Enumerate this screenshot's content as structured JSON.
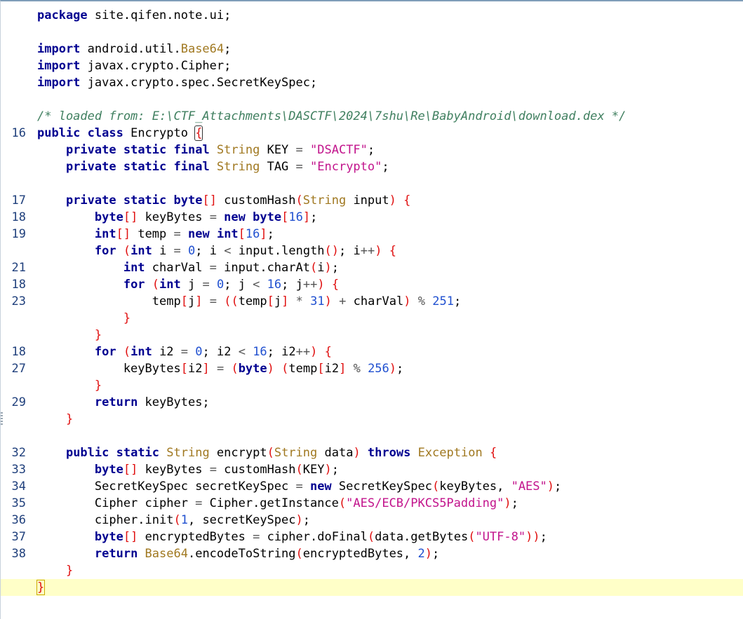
{
  "editor": {
    "lines": [
      {
        "n": "",
        "tokens": [
          [
            "kw",
            "package"
          ],
          [
            "",
            "site.qifen.note.ui;"
          ]
        ]
      },
      {
        "n": "",
        "tokens": []
      },
      {
        "n": "",
        "tokens": [
          [
            "kw",
            "import"
          ],
          [
            "",
            "android.util."
          ],
          [
            "ty",
            "Base64"
          ],
          [
            "",
            ";"
          ]
        ]
      },
      {
        "n": "",
        "tokens": [
          [
            "kw",
            "import"
          ],
          [
            "",
            "javax.crypto.Cipher;"
          ]
        ]
      },
      {
        "n": "",
        "tokens": [
          [
            "kw",
            "import"
          ],
          [
            "",
            "javax.crypto.spec.SecretKeySpec;"
          ]
        ]
      },
      {
        "n": "",
        "tokens": []
      },
      {
        "n": "",
        "tokens": [
          [
            "cm",
            "/* loaded from: E:\\CTF_Attachments\\DASCTF\\2024\\7shu\\Re\\BabyAndroid\\download.dex */"
          ]
        ]
      },
      {
        "n": "16",
        "tokens": [
          [
            "kw",
            "public"
          ],
          [
            "kw",
            "class"
          ],
          [
            "",
            "Encrypto "
          ],
          [
            "bm",
            "{"
          ]
        ]
      },
      {
        "n": "",
        "tokens": [
          [
            "",
            "    "
          ],
          [
            "kw",
            "private"
          ],
          [
            "kw",
            "static"
          ],
          [
            "kw",
            "final"
          ],
          [
            "ty",
            "String"
          ],
          [
            "",
            "KEY "
          ],
          [
            "op",
            "="
          ],
          [
            "str",
            " \"DSACTF\""
          ],
          [
            "",
            ";"
          ]
        ]
      },
      {
        "n": "",
        "tokens": [
          [
            "",
            "    "
          ],
          [
            "kw",
            "private"
          ],
          [
            "kw",
            "static"
          ],
          [
            "kw",
            "final"
          ],
          [
            "ty",
            "String"
          ],
          [
            "",
            "TAG "
          ],
          [
            "op",
            "="
          ],
          [
            "str",
            " \"Encrypto\""
          ],
          [
            "",
            ";"
          ]
        ]
      },
      {
        "n": "",
        "tokens": []
      },
      {
        "n": "17",
        "tokens": [
          [
            "",
            "    "
          ],
          [
            "kw",
            "private"
          ],
          [
            "kw",
            "static"
          ],
          [
            "kw",
            "byte"
          ],
          [
            "pu",
            "[]"
          ],
          [
            "",
            "",
            " customHash"
          ],
          [
            "pu",
            "("
          ],
          [
            "ty",
            "String"
          ],
          [
            "",
            " input"
          ],
          [
            "pu",
            ")"
          ],
          [
            "",
            "",
            " "
          ],
          [
            "pu",
            "{"
          ]
        ]
      },
      {
        "n": "18",
        "tokens": [
          [
            "",
            "        "
          ],
          [
            "kw",
            "byte"
          ],
          [
            "pu",
            "[]"
          ],
          [
            "",
            " keyBytes "
          ],
          [
            "op",
            "="
          ],
          [
            "kw",
            " new"
          ],
          [
            "kw",
            " byte"
          ],
          [
            "pu",
            "["
          ],
          [
            "nu",
            "16"
          ],
          [
            "pu",
            "]"
          ],
          [
            "",
            ";"
          ]
        ]
      },
      {
        "n": "19",
        "tokens": [
          [
            "",
            "        "
          ],
          [
            "kw",
            "int"
          ],
          [
            "pu",
            "[]"
          ],
          [
            "",
            " temp "
          ],
          [
            "op",
            "="
          ],
          [
            "kw",
            " new"
          ],
          [
            "kw",
            " int"
          ],
          [
            "pu",
            "["
          ],
          [
            "nu",
            "16"
          ],
          [
            "pu",
            "]"
          ],
          [
            "",
            ";"
          ]
        ]
      },
      {
        "n": "",
        "tokens": [
          [
            "",
            "        "
          ],
          [
            "kw",
            "for"
          ],
          [
            "",
            " "
          ],
          [
            "pu",
            "("
          ],
          [
            "kw",
            "int"
          ],
          [
            "",
            " i "
          ],
          [
            "op",
            "="
          ],
          [
            "nu",
            " 0"
          ],
          [
            "",
            "; i "
          ],
          [
            "op",
            "<"
          ],
          [
            "",
            " input.length"
          ],
          [
            "pu",
            "()"
          ],
          [
            "",
            "; i"
          ],
          [
            "op",
            "++"
          ],
          [
            "pu",
            ")"
          ],
          [
            "",
            " "
          ],
          [
            "pu",
            "{"
          ]
        ]
      },
      {
        "n": "21",
        "tokens": [
          [
            "",
            "            "
          ],
          [
            "kw",
            "int"
          ],
          [
            "",
            " charVal "
          ],
          [
            "op",
            "="
          ],
          [
            "",
            " input.charAt"
          ],
          [
            "pu",
            "("
          ],
          [
            "",
            "i"
          ],
          [
            "pu",
            ")"
          ],
          [
            "",
            ";"
          ]
        ]
      },
      {
        "n": "18",
        "tokens": [
          [
            "",
            "            "
          ],
          [
            "kw",
            "for"
          ],
          [
            "",
            " "
          ],
          [
            "pu",
            "("
          ],
          [
            "kw",
            "int"
          ],
          [
            "",
            " j "
          ],
          [
            "op",
            "="
          ],
          [
            "nu",
            " 0"
          ],
          [
            "",
            "; j "
          ],
          [
            "op",
            "<"
          ],
          [
            "nu",
            " 16"
          ],
          [
            "",
            "; j"
          ],
          [
            "op",
            "++"
          ],
          [
            "pu",
            ")"
          ],
          [
            "",
            " "
          ],
          [
            "pu",
            "{"
          ]
        ]
      },
      {
        "n": "23",
        "tokens": [
          [
            "",
            "                temp"
          ],
          [
            "pu",
            "["
          ],
          [
            "",
            "j"
          ],
          [
            "pu",
            "]"
          ],
          [
            "",
            " "
          ],
          [
            "op",
            "="
          ],
          [
            "",
            " "
          ],
          [
            "pu",
            "(("
          ],
          [
            "",
            "temp"
          ],
          [
            "pu",
            "["
          ],
          [
            "",
            "j"
          ],
          [
            "pu",
            "]"
          ],
          [
            "",
            " "
          ],
          [
            "op",
            "*"
          ],
          [
            "nu",
            " 31"
          ],
          [
            "pu",
            ")"
          ],
          [
            "",
            " "
          ],
          [
            "op",
            "+"
          ],
          [
            "",
            " charVal"
          ],
          [
            "pu",
            ")"
          ],
          [
            "",
            " "
          ],
          [
            "op",
            "%"
          ],
          [
            "nu",
            " 251"
          ],
          [
            "",
            ";"
          ]
        ]
      },
      {
        "n": "",
        "tokens": [
          [
            "",
            "            "
          ],
          [
            "pu",
            "}"
          ]
        ]
      },
      {
        "n": "",
        "tokens": [
          [
            "",
            "        "
          ],
          [
            "pu",
            "}"
          ]
        ]
      },
      {
        "n": "18",
        "tokens": [
          [
            "",
            "        "
          ],
          [
            "kw",
            "for"
          ],
          [
            "",
            " "
          ],
          [
            "pu",
            "("
          ],
          [
            "kw",
            "int"
          ],
          [
            "",
            " i2 "
          ],
          [
            "op",
            "="
          ],
          [
            "nu",
            " 0"
          ],
          [
            "",
            "; i2 "
          ],
          [
            "op",
            "<"
          ],
          [
            "nu",
            " 16"
          ],
          [
            "",
            "; i2"
          ],
          [
            "op",
            "++"
          ],
          [
            "pu",
            ")"
          ],
          [
            "",
            " "
          ],
          [
            "pu",
            "{"
          ]
        ]
      },
      {
        "n": "27",
        "tokens": [
          [
            "",
            "            keyBytes"
          ],
          [
            "pu",
            "["
          ],
          [
            "",
            "i2"
          ],
          [
            "pu",
            "]"
          ],
          [
            "",
            " "
          ],
          [
            "op",
            "="
          ],
          [
            "",
            " "
          ],
          [
            "pu",
            "("
          ],
          [
            "kw",
            "byte"
          ],
          [
            "pu",
            ")"
          ],
          [
            "",
            " "
          ],
          [
            "pu",
            "("
          ],
          [
            "",
            "temp"
          ],
          [
            "pu",
            "["
          ],
          [
            "",
            "i2"
          ],
          [
            "pu",
            "]"
          ],
          [
            "",
            " "
          ],
          [
            "op",
            "%"
          ],
          [
            "nu",
            " 256"
          ],
          [
            "pu",
            ")"
          ],
          [
            "",
            ";"
          ]
        ]
      },
      {
        "n": "",
        "tokens": [
          [
            "",
            "        "
          ],
          [
            "pu",
            "}"
          ]
        ]
      },
      {
        "n": "29",
        "tokens": [
          [
            "",
            "        "
          ],
          [
            "kw",
            "return"
          ],
          [
            "",
            " keyBytes;"
          ]
        ]
      },
      {
        "n": "",
        "tokens": [
          [
            "",
            "    "
          ],
          [
            "pu",
            "}"
          ]
        ]
      },
      {
        "n": "",
        "tokens": []
      },
      {
        "n": "32",
        "tokens": [
          [
            "",
            "    "
          ],
          [
            "kw",
            "public"
          ],
          [
            "kw",
            "static"
          ],
          [
            "ty",
            "String"
          ],
          [
            "",
            " encrypt"
          ],
          [
            "pu",
            "("
          ],
          [
            "ty",
            "String"
          ],
          [
            "",
            " data"
          ],
          [
            "pu",
            ")"
          ],
          [
            "kw",
            " throws"
          ],
          [
            "ty",
            " Exception"
          ],
          [
            "",
            " "
          ],
          [
            "pu",
            "{"
          ]
        ]
      },
      {
        "n": "33",
        "tokens": [
          [
            "",
            "        "
          ],
          [
            "kw",
            "byte"
          ],
          [
            "pu",
            "[]"
          ],
          [
            "",
            " keyBytes "
          ],
          [
            "op",
            "="
          ],
          [
            "",
            " customHash"
          ],
          [
            "pu",
            "("
          ],
          [
            "",
            "KEY"
          ],
          [
            "pu",
            ")"
          ],
          [
            "",
            ";"
          ]
        ]
      },
      {
        "n": "34",
        "tokens": [
          [
            "",
            "        SecretKeySpec secretKeySpec "
          ],
          [
            "op",
            "="
          ],
          [
            "kw",
            " new"
          ],
          [
            "",
            " SecretKeySpec"
          ],
          [
            "pu",
            "("
          ],
          [
            "",
            "keyBytes, "
          ],
          [
            "str",
            "\"AES\""
          ],
          [
            "pu",
            ")"
          ],
          [
            "",
            ";"
          ]
        ]
      },
      {
        "n": "35",
        "tokens": [
          [
            "",
            "        Cipher cipher "
          ],
          [
            "op",
            "="
          ],
          [
            "",
            " Cipher.getInstance"
          ],
          [
            "pu",
            "("
          ],
          [
            "str",
            "\"AES/ECB/PKCS5Padding\""
          ],
          [
            "pu",
            ")"
          ],
          [
            "",
            ";"
          ]
        ]
      },
      {
        "n": "36",
        "tokens": [
          [
            "",
            "        cipher.init"
          ],
          [
            "pu",
            "("
          ],
          [
            "nu",
            "1"
          ],
          [
            "",
            ", secretKeySpec"
          ],
          [
            "pu",
            ")"
          ],
          [
            "",
            ";"
          ]
        ]
      },
      {
        "n": "37",
        "tokens": [
          [
            "",
            "        "
          ],
          [
            "kw",
            "byte"
          ],
          [
            "pu",
            "[]"
          ],
          [
            "",
            " encryptedBytes "
          ],
          [
            "op",
            "="
          ],
          [
            "",
            " cipher.doFinal"
          ],
          [
            "pu",
            "("
          ],
          [
            "",
            "data.getBytes"
          ],
          [
            "pu",
            "("
          ],
          [
            "str",
            "\"UTF-8\""
          ],
          [
            "pu",
            "))"
          ],
          [
            "",
            ";"
          ]
        ]
      },
      {
        "n": "38",
        "tokens": [
          [
            "",
            "        "
          ],
          [
            "kw",
            "return"
          ],
          [
            "ty",
            " Base64"
          ],
          [
            "",
            ".encodeToString"
          ],
          [
            "pu",
            "("
          ],
          [
            "",
            "encryptedBytes, "
          ],
          [
            "nu",
            "2"
          ],
          [
            "pu",
            ")"
          ],
          [
            "",
            ";"
          ]
        ]
      },
      {
        "n": "",
        "tokens": [
          [
            "",
            "    "
          ],
          [
            "pu",
            "}"
          ]
        ]
      },
      {
        "n": "",
        "tokens": [
          [
            "bm2",
            "}"
          ],
          [
            "caret",
            ""
          ]
        ],
        "current": true
      }
    ]
  }
}
